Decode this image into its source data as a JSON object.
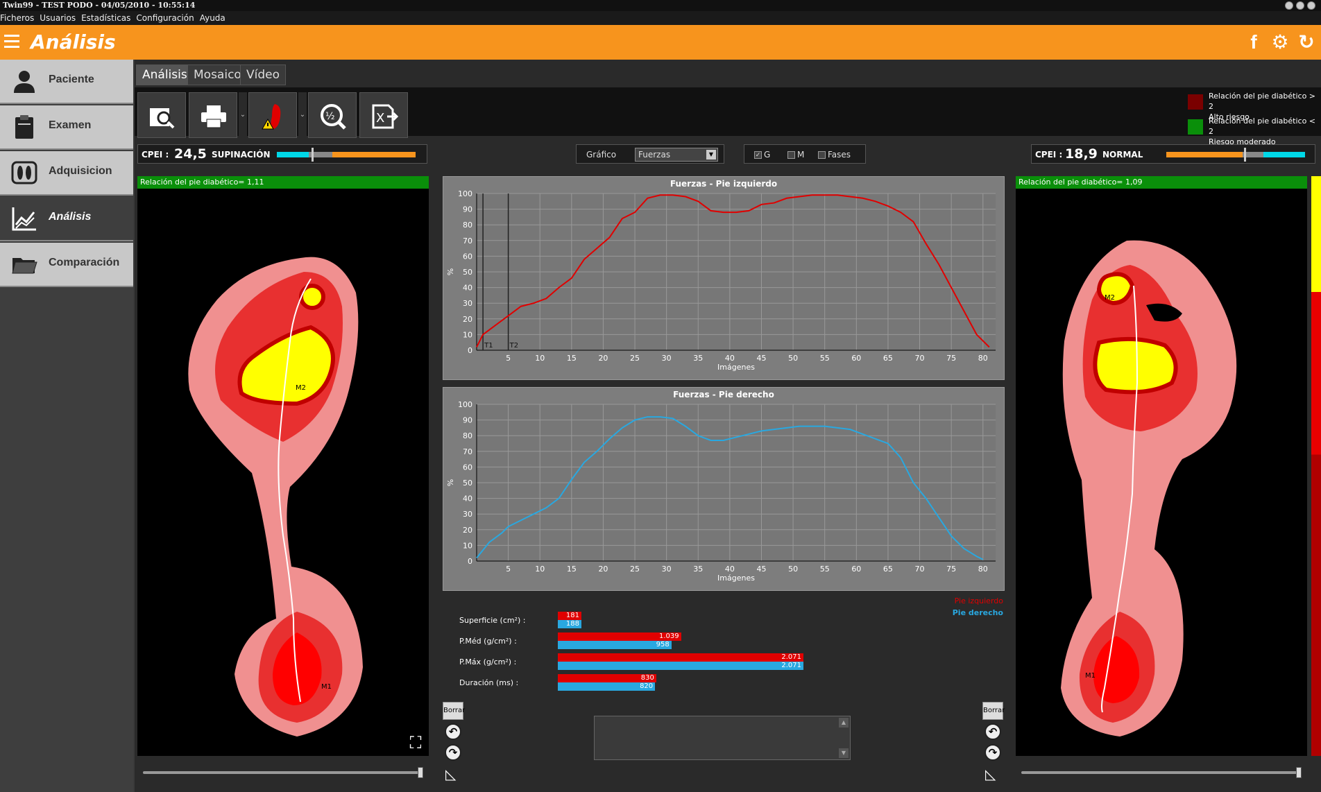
{
  "window": {
    "title": "Twin99 - TEST PODO - 04/05/2010 - 10:55:14"
  },
  "menu": [
    "Ficheros",
    "Usuarios",
    "Estadísticas",
    "Configuración",
    "Ayuda"
  ],
  "header": {
    "title": "Análisis",
    "icons": [
      "facebook-icon",
      "gear-icon",
      "refresh-icon"
    ]
  },
  "sidebar": {
    "items": [
      {
        "label": "Paciente",
        "icon": "user-icon",
        "active": false
      },
      {
        "label": "Examen",
        "icon": "clipboard-icon",
        "active": false
      },
      {
        "label": "Adquisicion",
        "icon": "footprint-icon",
        "active": false
      },
      {
        "label": "Análisis",
        "icon": "chart-icon",
        "active": true
      },
      {
        "label": "Comparación",
        "icon": "folder-icon",
        "active": false
      }
    ]
  },
  "tabs": [
    {
      "label": "Análisis",
      "active": true
    },
    {
      "label": "Mosaico",
      "active": false
    },
    {
      "label": "Vídeo",
      "active": false
    }
  ],
  "toolbar": {
    "icons": [
      "preview-icon",
      "print-icon",
      "foot-alert-icon",
      "zoom-ratio-icon",
      "excel-export-icon"
    ]
  },
  "legend": [
    {
      "text1": "Relación del pie diabético > 2",
      "text2": "Alto riesgo",
      "color": "#7a0000"
    },
    {
      "text1": "Relación del pie diabético < 2",
      "text2": "Riesgo moderado",
      "color": "#0a8f0a"
    }
  ],
  "left_cpei": {
    "key": "CPEI :",
    "value": "24,5",
    "status": "SUPINACIÓN"
  },
  "right_cpei": {
    "key": "CPEI :",
    "value": "18,9",
    "status": "NORMAL"
  },
  "grafico": {
    "label": "Gráfico",
    "selected": "Fuerzas"
  },
  "checks": [
    {
      "label": "G",
      "checked": true
    },
    {
      "label": "M",
      "checked": false
    },
    {
      "label": "Fases",
      "checked": false
    }
  ],
  "left_ratio": "Relación del pie diabético= 1,11",
  "right_ratio": "Relación del pie diabético= 1,09",
  "left_foot_labels": {
    "m2": "M2",
    "m1": "M1"
  },
  "right_foot_labels": {
    "m2": "M2",
    "m1": "M1"
  },
  "chart_data": [
    {
      "type": "line",
      "title": "Fuerzas - Pie izquierdo",
      "xlabel": "Imágenes",
      "ylabel": "%",
      "xlim": [
        0,
        82
      ],
      "ylim": [
        0,
        100
      ],
      "xticks": [
        5,
        10,
        15,
        20,
        25,
        30,
        35,
        40,
        45,
        50,
        55,
        60,
        65,
        70,
        75,
        80
      ],
      "yticks": [
        0,
        10,
        20,
        30,
        40,
        50,
        60,
        70,
        80,
        90,
        100
      ],
      "markers": [
        {
          "label": "T1",
          "x": 1
        },
        {
          "label": "T2",
          "x": 5
        }
      ],
      "color": "#e00000",
      "x": [
        0,
        1,
        3,
        5,
        7,
        9,
        11,
        13,
        15,
        17,
        19,
        21,
        23,
        25,
        27,
        29,
        31,
        33,
        35,
        37,
        39,
        41,
        43,
        45,
        47,
        49,
        51,
        53,
        55,
        57,
        59,
        61,
        63,
        65,
        67,
        69,
        71,
        73,
        75,
        77,
        79,
        81
      ],
      "values": [
        2,
        10,
        16,
        22,
        28,
        30,
        33,
        40,
        46,
        58,
        65,
        72,
        84,
        88,
        97,
        99,
        99,
        98,
        95,
        89,
        88,
        88,
        89,
        93,
        94,
        97,
        98,
        99,
        99,
        99,
        98,
        97,
        95,
        92,
        88,
        82,
        68,
        55,
        40,
        25,
        10,
        2
      ]
    },
    {
      "type": "line",
      "title": "Fuerzas - Pie derecho",
      "xlabel": "Imágenes",
      "ylabel": "%",
      "xlim": [
        0,
        82
      ],
      "ylim": [
        0,
        100
      ],
      "xticks": [
        5,
        10,
        15,
        20,
        25,
        30,
        35,
        40,
        45,
        50,
        55,
        60,
        65,
        70,
        75,
        80
      ],
      "yticks": [
        0,
        10,
        20,
        30,
        40,
        50,
        60,
        70,
        80,
        90,
        100
      ],
      "color": "#29a8e0",
      "x": [
        0,
        2,
        4,
        5,
        7,
        9,
        11,
        13,
        15,
        17,
        19,
        21,
        23,
        25,
        27,
        29,
        31,
        33,
        35,
        37,
        39,
        41,
        43,
        45,
        47,
        49,
        51,
        53,
        55,
        57,
        59,
        61,
        63,
        65,
        67,
        69,
        71,
        73,
        75,
        77,
        79,
        80
      ],
      "values": [
        2,
        12,
        18,
        22,
        26,
        30,
        34,
        40,
        52,
        63,
        70,
        78,
        85,
        90,
        92,
        92,
        91,
        86,
        80,
        77,
        77,
        79,
        81,
        83,
        84,
        85,
        86,
        86,
        86,
        85,
        84,
        81,
        78,
        75,
        66,
        50,
        40,
        28,
        16,
        8,
        3,
        1
      ]
    },
    {
      "type": "bar",
      "categories": [
        "Superficie (cm²) :",
        "P.Méd (g/cm²) :",
        "P.Máx (g/cm²) :",
        "Duración (ms) :"
      ],
      "series": [
        {
          "name": "Pie izquierdo",
          "color": "#e00000",
          "values": [
            181,
            1039,
            2071,
            830
          ],
          "labels": [
            "181",
            "1.039",
            "2.071",
            "830"
          ]
        },
        {
          "name": "Pie derecho",
          "color": "#29a8e0",
          "values": [
            188,
            958,
            2071,
            820
          ],
          "labels": [
            "188",
            "958",
            "2.071",
            "820"
          ]
        }
      ],
      "max_ref": 2071
    }
  ],
  "buttons": {
    "borrar": "Borrar"
  }
}
